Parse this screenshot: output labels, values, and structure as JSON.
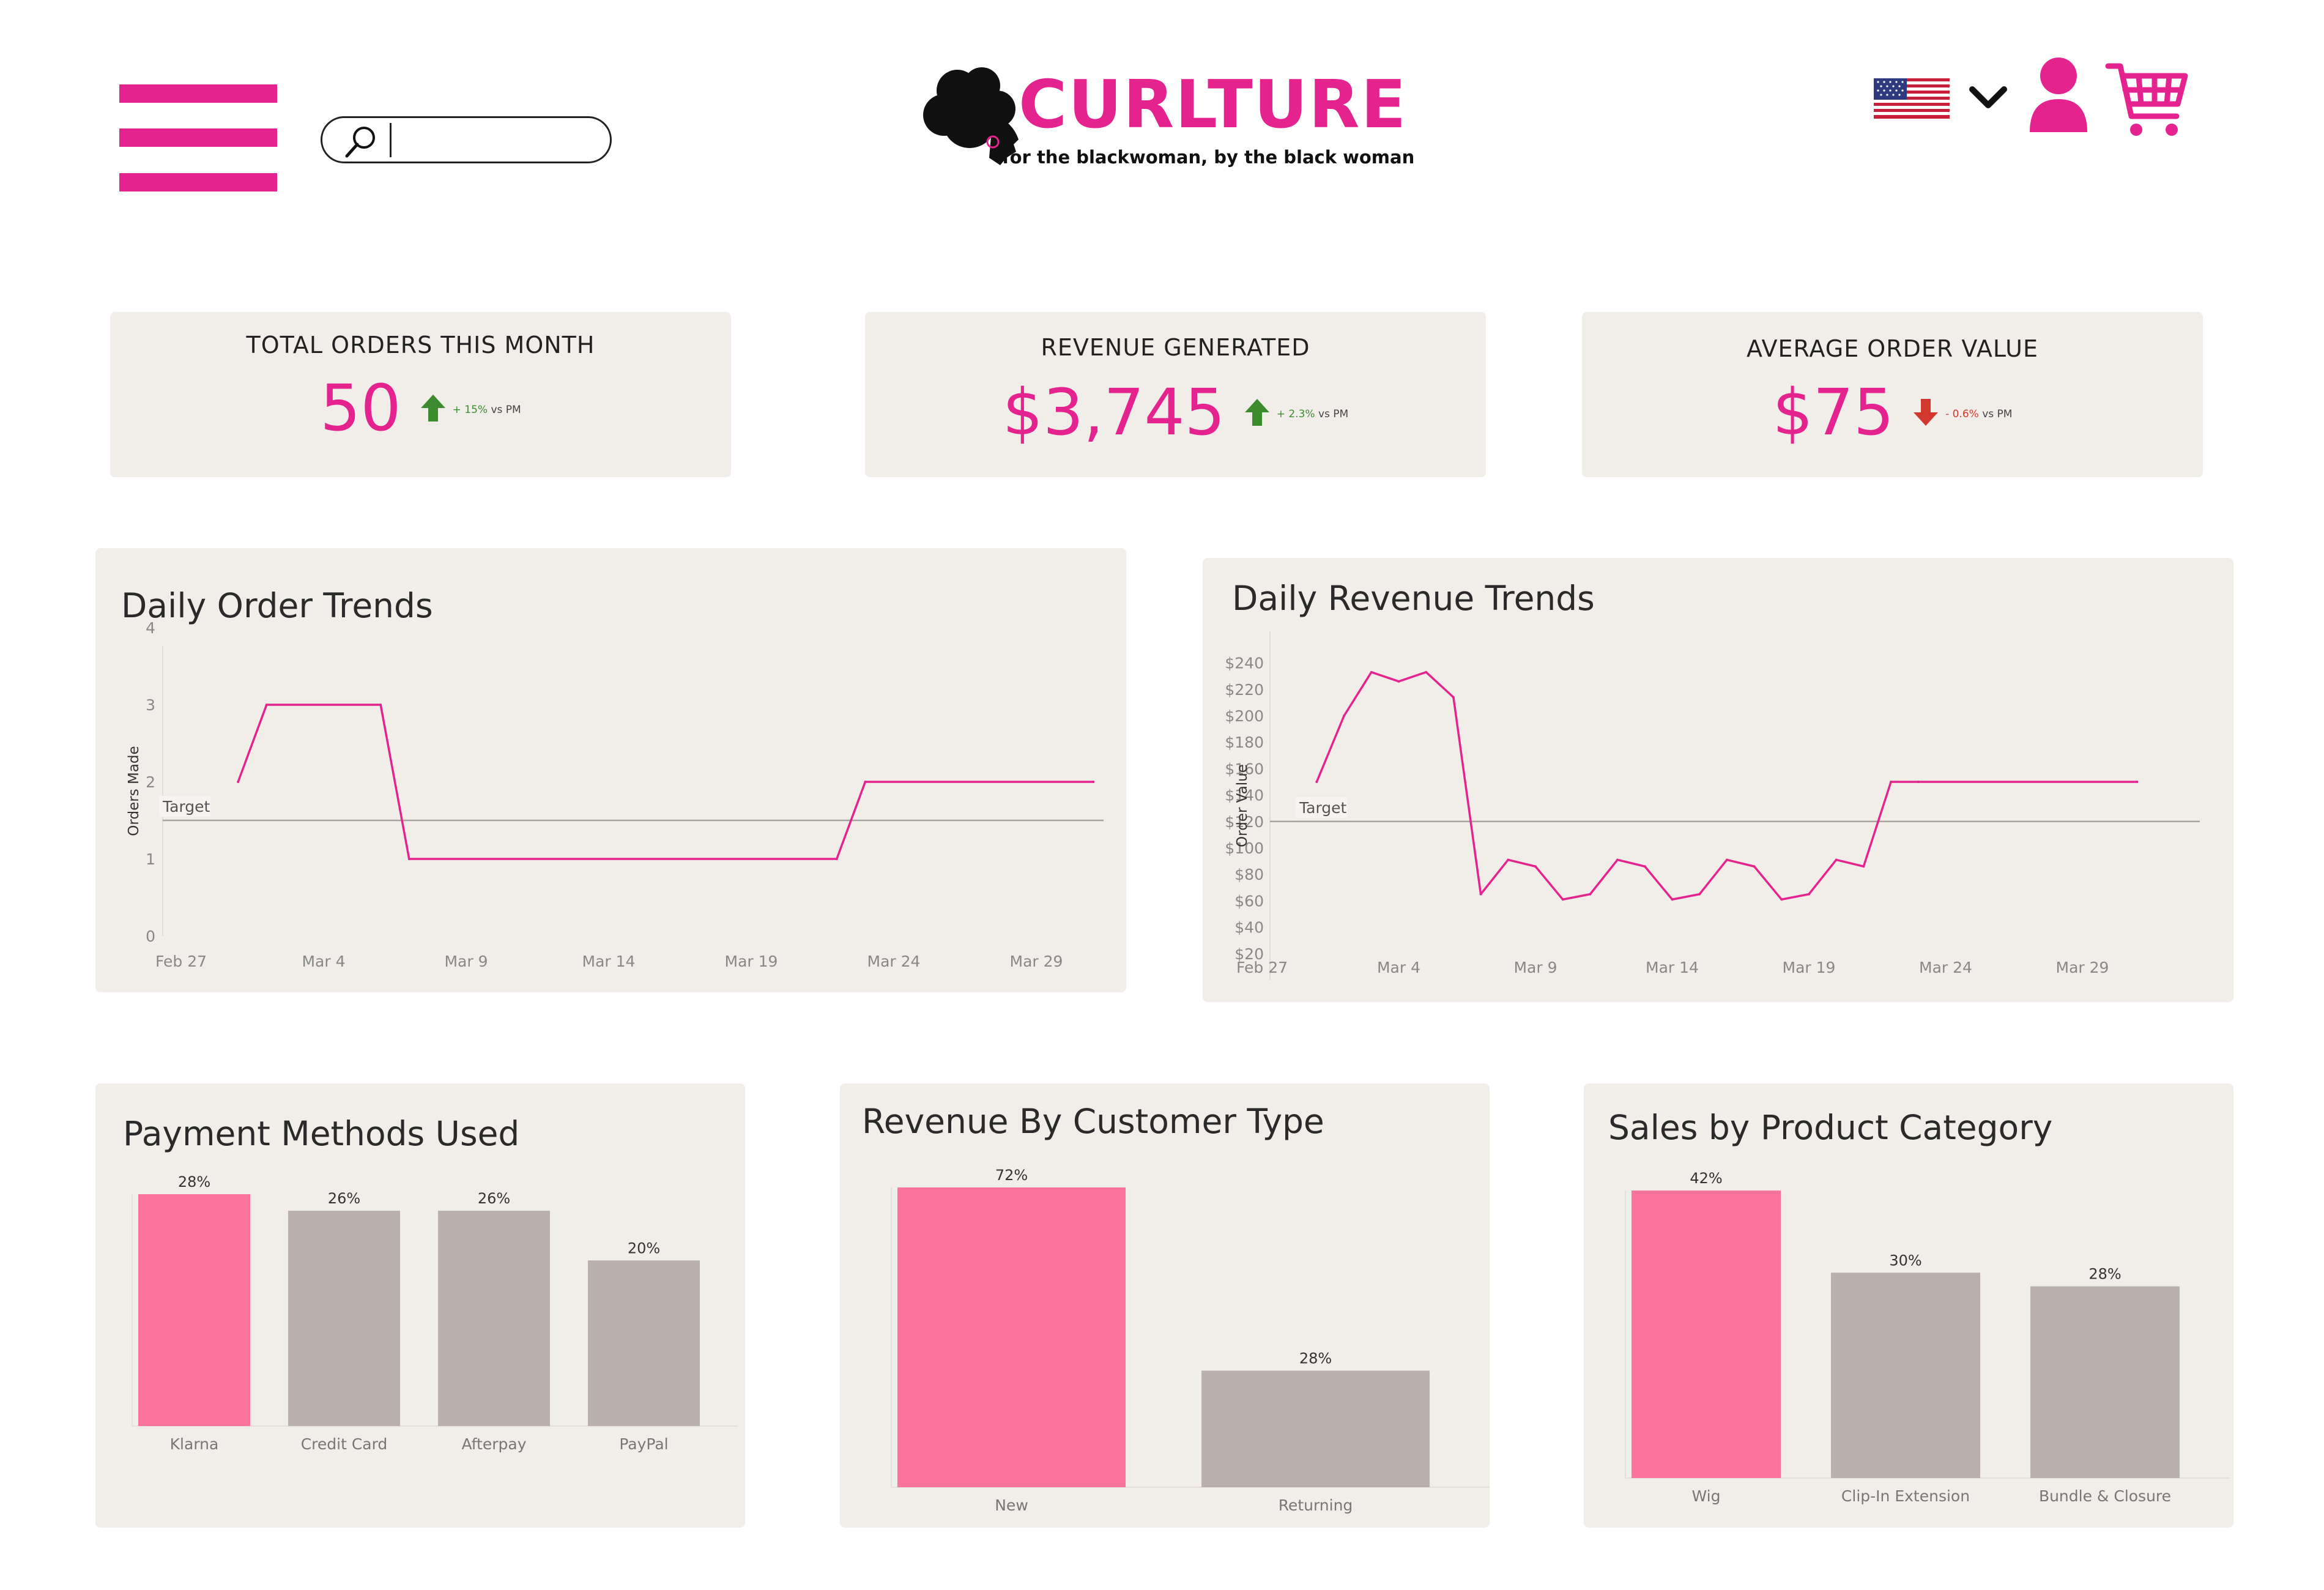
{
  "header": {
    "search": {
      "placeholder": "",
      "value": ""
    },
    "logo": {
      "name": "CURLTURE",
      "tagline": "for the blackwoman, by the black woman"
    },
    "language_flag": "us-flag-icon"
  },
  "colors": {
    "accent": "#e5238f",
    "bar_highlight": "#fb749f",
    "bar_muted": "#bab0ab",
    "card_bg": "#f1eeea",
    "up": "#3d8b2f",
    "down": "#d2382e"
  },
  "kpis": [
    {
      "title": "TOTAL ORDERS THIS MONTH",
      "value": "50",
      "delta": "+ 15%",
      "delta_suffix": "vs PM",
      "direction": "up"
    },
    {
      "title": "REVENUE GENERATED",
      "value": "$3,745",
      "delta": "+ 2.3%",
      "delta_suffix": "vs PM",
      "direction": "up"
    },
    {
      "title": "AVERAGE ORDER VALUE",
      "value": "$75",
      "delta": "- 0.6%",
      "delta_suffix": "vs PM",
      "direction": "down"
    }
  ],
  "chart_data": [
    {
      "type": "line",
      "title": "Daily Order Trends",
      "ylabel": "Orders Made",
      "xlabel": "",
      "ylim": [
        0,
        4
      ],
      "yticks": [
        "0",
        "1",
        "2",
        "3",
        "4"
      ],
      "xticks": [
        "Feb 27",
        "Mar 4",
        "Mar 9",
        "Mar 14",
        "Mar 19",
        "Mar 24",
        "Mar 29"
      ],
      "target_label": "Target",
      "target": 1.5,
      "x": [
        "Mar 1",
        "Mar 2",
        "Mar 6",
        "Mar 7",
        "Mar 22",
        "Mar 23",
        "Mar 31"
      ],
      "values": [
        2,
        3,
        3,
        1,
        1,
        2,
        2
      ]
    },
    {
      "type": "line",
      "title": "Daily Revenue Trends",
      "ylabel": "Order Value",
      "xlabel": "",
      "ylim": [
        0,
        240
      ],
      "yticks": [
        "$20",
        "$40",
        "$60",
        "$80",
        "$100",
        "$120",
        "$140",
        "$160",
        "$180",
        "$200",
        "$220",
        "$240"
      ],
      "xticks": [
        "Feb 27",
        "Mar 4",
        "Mar 9",
        "Mar 14",
        "Mar 19",
        "Mar 24",
        "Mar 29"
      ],
      "target_label": "Target",
      "target": 120,
      "x": [
        "Mar 1",
        "Mar 2",
        "Mar 3",
        "Mar 4",
        "Mar 5",
        "Mar 6",
        "Mar 7",
        "Mar 8",
        "Mar 9",
        "Mar 10",
        "Mar 11",
        "Mar 12",
        "Mar 13",
        "Mar 14",
        "Mar 15",
        "Mar 16",
        "Mar 17",
        "Mar 18",
        "Mar 19",
        "Mar 20",
        "Mar 21",
        "Mar 22",
        "Mar 23",
        "Mar 31"
      ],
      "values": [
        150,
        200,
        233,
        226,
        233,
        214,
        65,
        91,
        86,
        61,
        65,
        91,
        86,
        61,
        65,
        91,
        86,
        61,
        65,
        91,
        86,
        150,
        150,
        150
      ]
    },
    {
      "type": "bar",
      "title": "Payment Methods Used",
      "categories": [
        "Klarna",
        "Credit Card",
        "Afterpay",
        "PayPal"
      ],
      "values": [
        28,
        26,
        26,
        20
      ],
      "labels": [
        "28%",
        "26%",
        "26%",
        "20%"
      ],
      "highlight": 0
    },
    {
      "type": "bar",
      "title": "Revenue By Customer Type",
      "categories": [
        "New",
        "Returning"
      ],
      "values": [
        72,
        28
      ],
      "labels": [
        "72%",
        "28%"
      ],
      "highlight": 0
    },
    {
      "type": "bar",
      "title": "Sales by Product Category",
      "categories": [
        "Wig",
        "Clip-In Extension",
        "Bundle & Closure"
      ],
      "values": [
        42,
        30,
        28
      ],
      "labels": [
        "42%",
        "30%",
        "28%"
      ],
      "highlight": 0
    }
  ]
}
